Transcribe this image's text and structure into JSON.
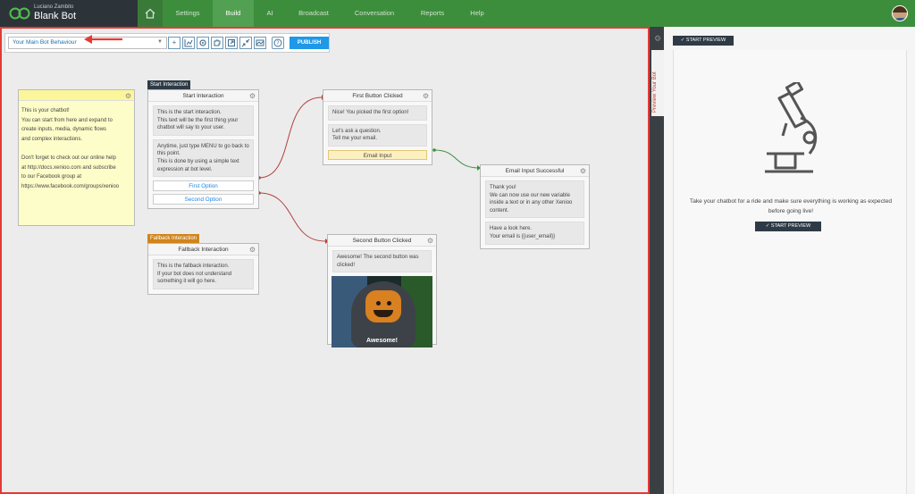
{
  "brand": {
    "user_name": "Luciano Zambito",
    "bot_name": "Blank Bot"
  },
  "nav": {
    "items": [
      "Settings",
      "Build",
      "AI",
      "Broadcast",
      "Conversation",
      "Reports",
      "Help"
    ],
    "active": "Build"
  },
  "toolbar": {
    "behaviour_value": "Your Main Bot Behaviour",
    "publish_label": "PUBLISH"
  },
  "note": {
    "lines": [
      "This is your chatbot!",
      "You can start from here and expand to",
      "create inputs, media, dynamic flows",
      "and complex interactions.",
      "",
      "Don't forget to check out our online help",
      "at http://docs.xenioo.com and subscribe",
      "to our Facebook group at",
      "https://www.facebook.com/groups/xenioo"
    ]
  },
  "tags": {
    "start": "Start Interaction",
    "fallback": "Fallback Interaction"
  },
  "cards": {
    "start": {
      "title": "Start Interaction",
      "msg1": "This is the start interaction.\nThis text will be the first thing your chatbot will say to your user.",
      "msg2": "Anytime, just type MENU to go back to this point.\nThis is done by using a simple text expression at bot level.",
      "option1": "First Option",
      "option2": "Second Option"
    },
    "fallback": {
      "title": "Fallback Interaction",
      "msg1": "This is the fallback interaction.\nIf your bot does not understand something it will go here."
    },
    "first_clicked": {
      "title": "First Button Clicked",
      "msg1": "Nice! You picked the first option!",
      "msg2": "Let's ask a question.\nTell me your email.",
      "input": "Email Input"
    },
    "email_success": {
      "title": "Email Input Successful",
      "msg1": "Thank you!\nWe can now use our new variable inside a text or in any other Xenioo content.",
      "msg2": "Have a look here.\nYour email is {{user_email}}"
    },
    "second_clicked": {
      "title": "Second Button Clicked",
      "msg1": "Awesome! The second button was clicked!",
      "gif_caption": "Awesome!"
    }
  },
  "preview": {
    "tab_label": "Preview Your Bot",
    "start_label": "START PREVIEW",
    "message": "Take your chatbot for a ride and make sure everything is working as expected before going live!"
  },
  "colors": {
    "nav_green": "#3d8e3c",
    "accent_blue": "#1f98e8",
    "highlight_red": "#e53935",
    "fallback_orange": "#d0841a"
  }
}
